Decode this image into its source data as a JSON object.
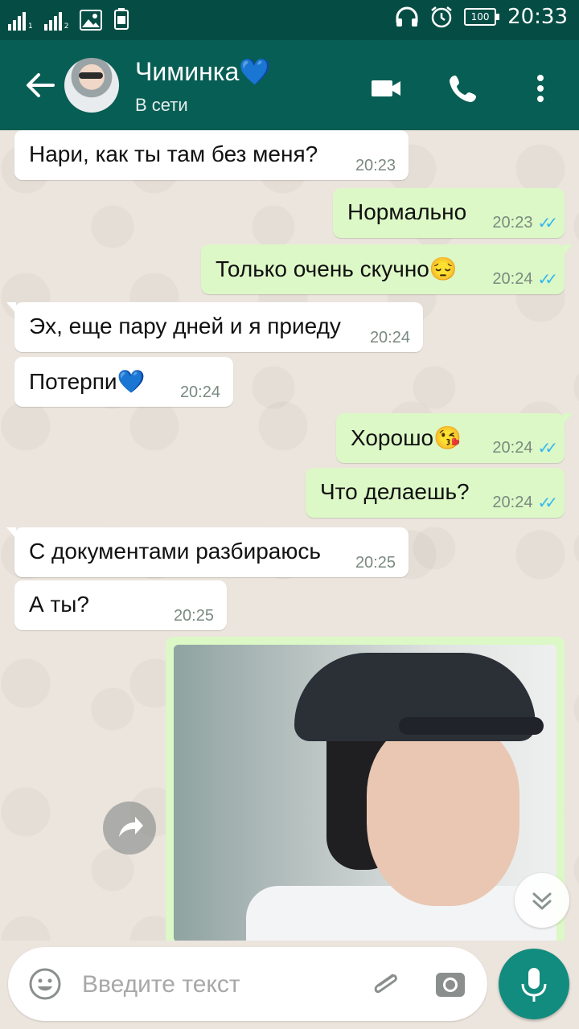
{
  "status_bar": {
    "sim1": "1",
    "sim2": "2",
    "battery": "100",
    "time": "20:33"
  },
  "header": {
    "contact_name": "Чиминка💙",
    "contact_status": "В сети"
  },
  "messages": [
    {
      "dir": "in",
      "text": "Нари, как ты там без меня?",
      "time": "20:23"
    },
    {
      "dir": "out",
      "text": "Нормально",
      "time": "20:23"
    },
    {
      "dir": "out",
      "text": "Только очень скучно😔",
      "time": "20:24"
    },
    {
      "dir": "in",
      "text": "Эх, еще пару дней и я приеду",
      "time": "20:24"
    },
    {
      "dir": "in",
      "text": "Потерпи💙",
      "time": "20:24"
    },
    {
      "dir": "out",
      "text": "Хорошо😘",
      "time": "20:24"
    },
    {
      "dir": "out",
      "text": "Что делаешь?",
      "time": "20:24"
    },
    {
      "dir": "in",
      "text": "С документами разбираюсь",
      "time": "20:25"
    },
    {
      "dir": "in",
      "text": "А ты?",
      "time": "20:25"
    }
  ],
  "input": {
    "placeholder": "Введите текст"
  },
  "colors": {
    "header": "#075e54",
    "statusbar": "#054d44",
    "incoming_bubble": "#ffffff",
    "outgoing_bubble": "#dcf8c6",
    "read_ticks": "#34b7f1",
    "mic_button": "#128c7e"
  }
}
